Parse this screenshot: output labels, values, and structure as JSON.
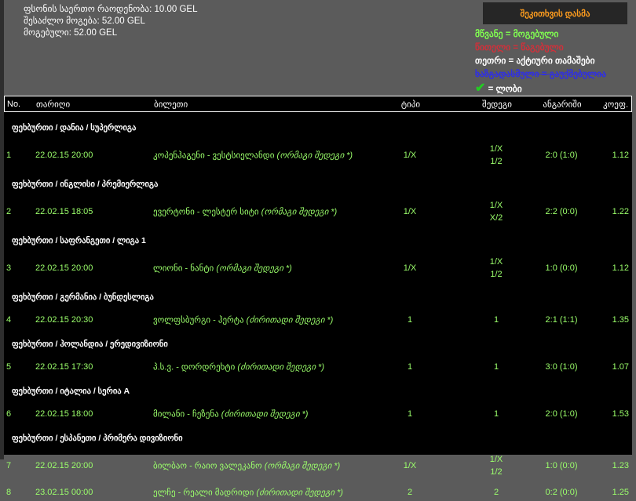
{
  "summary": {
    "total_bet": "ფსონის საერთო რაოდენობა: 10.00 GEL",
    "possible_win": "შესაძლო მოგება: 52.00 GEL",
    "won": "მოგებული: 52.00 GEL"
  },
  "ask_button": "შეკითხვის დასმა",
  "legend": {
    "green": "მწვანე = მოგებული",
    "red": "წითელი = წაგებული",
    "white": "თეთრი = აქტიური თამაშები",
    "blue": "ხაზგადასმული = გაუქმებულია",
    "check": "= ლობი"
  },
  "colors": {
    "background": "#5b5b5b",
    "table": "#000000",
    "win_text": "#9bff6b",
    "button_text": "#ff9d1e"
  },
  "columns": [
    "No.",
    "თარიღი",
    "ბილეთი",
    "ტიპი",
    "შედეგი",
    "ანგარიში",
    "კოეფ."
  ],
  "groups": [
    {
      "section": "ფეხბურთი / დანია / სუპერლიგა",
      "no": "1",
      "date": "22.02.15 20:00",
      "match": "კოპენჰაგენი - ვესტსიელანდი",
      "market": "(ორმაგი შედეგი *)",
      "type": "1/X",
      "result": [
        "1/X",
        "1/2"
      ],
      "score": "2:0 (1:0)",
      "coef": "1.12"
    },
    {
      "section": "ფეხბურთი / ინგლისი / პრემიერლიგა",
      "no": "2",
      "date": "22.02.15 18:05",
      "match": "ევერტონი - ლესტერ სიტი",
      "market": "(ორმაგი შედეგი *)",
      "type": "1/X",
      "result": [
        "1/X",
        "X/2"
      ],
      "score": "2:2 (0:0)",
      "coef": "1.22"
    },
    {
      "section": "ფეხბურთი / საფრანგეთი / ლიგა 1",
      "no": "3",
      "date": "22.02.15 20:00",
      "match": "ლიონი - ნანტი",
      "market": "(ორმაგი შედეგი *)",
      "type": "1/X",
      "result": [
        "1/X",
        "1/2"
      ],
      "score": "1:0 (0:0)",
      "coef": "1.12"
    },
    {
      "section": "ფეხბურთი / გერმანია / ბუნდესლიგა",
      "no": "4",
      "date": "22.02.15 20:30",
      "match": "ვოლფსბურგი - ჰერტა",
      "market": "(ძირითადი შედეგი *)",
      "type": "1",
      "result": [
        "1"
      ],
      "score": "2:1 (1:1)",
      "coef": "1.35"
    },
    {
      "section": "ფეხბურთი / ჰოლანდია / ერედივიზიონი",
      "no": "5",
      "date": "22.02.15 17:30",
      "match": "პ.ს.ვ. - დორდრეხტი",
      "market": "(ძირითადი შედეგი *)",
      "type": "1",
      "result": [
        "1"
      ],
      "score": "3:0 (1:0)",
      "coef": "1.07"
    },
    {
      "section": "ფეხბურთი / იტალია / სერია A",
      "no": "6",
      "date": "22.02.15 18:00",
      "match": "მილანი - ჩეზენა",
      "market": "(ძირითადი შედეგი *)",
      "type": "1",
      "result": [
        "1"
      ],
      "score": "2:0 (1:0)",
      "coef": "1.53"
    },
    {
      "section": "ფეხბურთი / ესპანეთი / პრიმერა დივიზიონი",
      "no": "7",
      "date": "22.02.15 20:00",
      "match": "ბილბაო - რაიო ვალეკანო",
      "market": "(ორმაგი შედეგი *)",
      "type": "1/X",
      "result": [
        "1/X",
        "1/2"
      ],
      "score": "1:0 (0:0)",
      "coef": "1.23"
    },
    {
      "section": "",
      "no": "8",
      "date": "23.02.15 00:00",
      "match": "ელჩე - რეალი მადრიდი",
      "market": "(ძირითადი შედეგი *)",
      "type": "2",
      "result": [
        "2"
      ],
      "score": "0:2 (0:0)",
      "coef": "1.25"
    }
  ]
}
